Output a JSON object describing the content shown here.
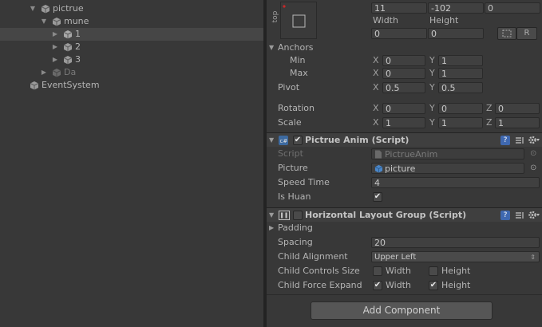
{
  "hierarchy": {
    "items": [
      {
        "label": "pictrue",
        "expanded": true
      },
      {
        "label": "mune",
        "expanded": true
      },
      {
        "label": "1"
      },
      {
        "label": "2"
      },
      {
        "label": "3"
      },
      {
        "label": "Da"
      },
      {
        "label": "EventSystem"
      }
    ]
  },
  "rect_transform": {
    "anchor_preset_label": "top",
    "pos_x": "11",
    "pos_y": "-102",
    "pos_z": "0",
    "width_label": "Width",
    "height_label": "Height",
    "width": "0",
    "height": "0",
    "r_button": "R",
    "anchors_label": "Anchors",
    "min_label": "Min",
    "max_label": "Max",
    "min_x": "0",
    "min_y": "1",
    "max_x": "0",
    "max_y": "1",
    "pivot_label": "Pivot",
    "pivot_x": "0.5",
    "pivot_y": "0.5",
    "rotation_label": "Rotation",
    "rot_x": "0",
    "rot_y": "0",
    "rot_z": "0",
    "scale_label": "Scale",
    "scale_x": "1",
    "scale_y": "1",
    "scale_z": "1",
    "axis_x": "X",
    "axis_y": "Y",
    "axis_z": "Z"
  },
  "pictrue_anim": {
    "title": "Pictrue Anim (Script)",
    "enabled": true,
    "script_label": "Script",
    "script_value": "PictrueAnim",
    "picture_label": "Picture",
    "picture_value": "picture",
    "speed_label": "Speed Time",
    "speed_value": "4",
    "is_huan_label": "Is Huan",
    "is_huan": true
  },
  "layout_group": {
    "title": "Horizontal Layout Group (Script)",
    "enabled": false,
    "padding_label": "Padding",
    "spacing_label": "Spacing",
    "spacing_value": "20",
    "alignment_label": "Child Alignment",
    "alignment_value": "Upper Left",
    "controls_label": "Child Controls Size",
    "controls_width": false,
    "controls_height": false,
    "expand_label": "Child Force Expand",
    "expand_width": true,
    "expand_height": true,
    "width_label": "Width",
    "height_label": "Height"
  },
  "add_component": "Add Component",
  "colors": {
    "panel": "#383838",
    "selection": "#464646",
    "anchor_accent": "#c82828",
    "script_icon_blue": "#4a86c8"
  }
}
